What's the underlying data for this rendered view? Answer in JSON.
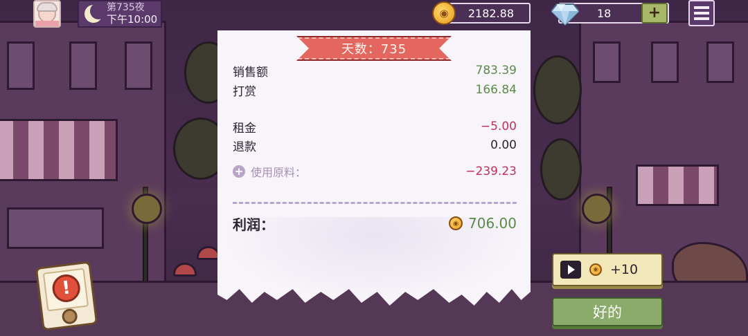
{
  "hud": {
    "day_label": "第735夜",
    "time": "下午10:00",
    "coins": "2182.88",
    "gems": "18",
    "plus": "+"
  },
  "receipt": {
    "title": "天数：735",
    "rows": [
      {
        "label": "销售额",
        "value": "783.39"
      },
      {
        "label": "打赏",
        "value": "166.84"
      },
      {
        "label": "租金",
        "value": "−5.00"
      },
      {
        "label": "退款",
        "value": "0.00"
      }
    ],
    "materials": {
      "label": "使用原料：",
      "value": "−239.23"
    },
    "profit": {
      "label": "利润：",
      "value": "706.00"
    }
  },
  "actions": {
    "ad_reward": "+10",
    "ok": "好的"
  },
  "alert": {
    "symbol": "!"
  },
  "colors": {
    "positive": "#5a8a4a",
    "negative": "#c0305a",
    "ribbon": "#e3675f",
    "ok_button": "#8aab6a",
    "ad_button": "#f2e7b8"
  }
}
